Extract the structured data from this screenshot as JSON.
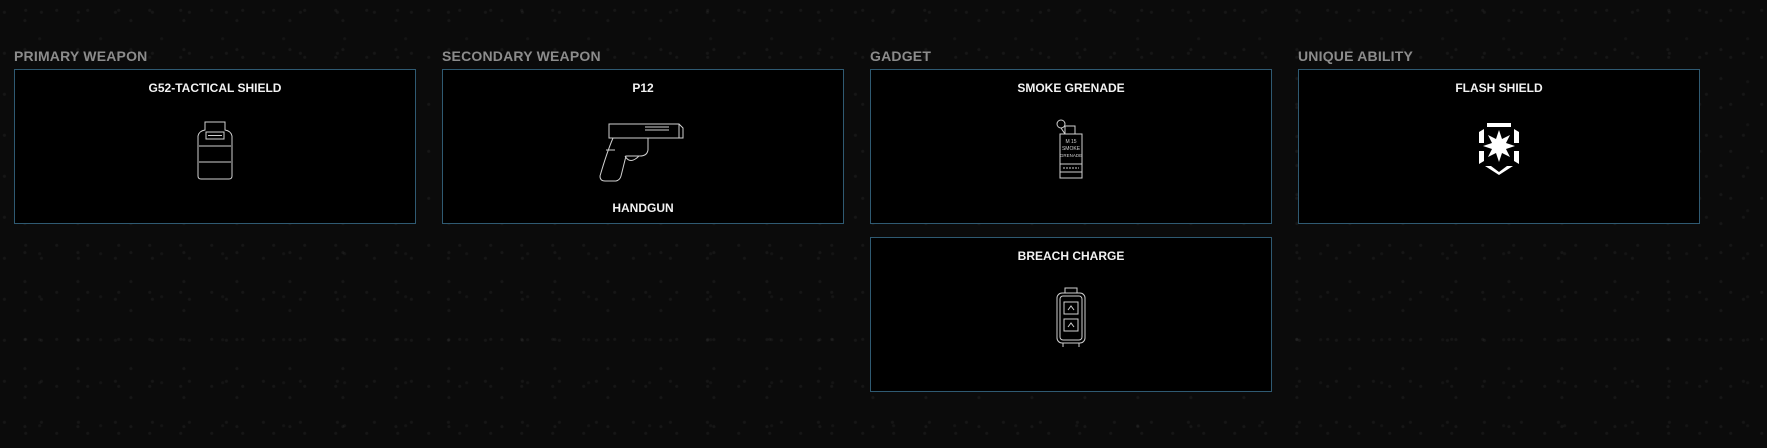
{
  "columns": [
    {
      "title": "PRIMARY WEAPON",
      "cards": [
        {
          "name": "G52-TACTICAL SHIELD",
          "icon": "tactical-shield-icon"
        }
      ]
    },
    {
      "title": "SECONDARY WEAPON",
      "cards": [
        {
          "name": "P12",
          "icon": "pistol-icon",
          "type": "HANDGUN"
        }
      ]
    },
    {
      "title": "GADGET",
      "cards": [
        {
          "name": "SMOKE GRENADE",
          "icon": "smoke-grenade-icon",
          "icon_text": [
            "M 15",
            "SMOKE",
            "GRENADE"
          ]
        },
        {
          "name": "BREACH CHARGE",
          "icon": "breach-charge-icon"
        }
      ]
    },
    {
      "title": "UNIQUE ABILITY",
      "cards": [
        {
          "name": "FLASH SHIELD",
          "icon": "flash-shield-icon"
        }
      ]
    }
  ],
  "colors": {
    "background": "#0b0b0b",
    "card_border": "#2f5a72",
    "title": "#8c8c8c",
    "text": "#f2f2f2"
  }
}
